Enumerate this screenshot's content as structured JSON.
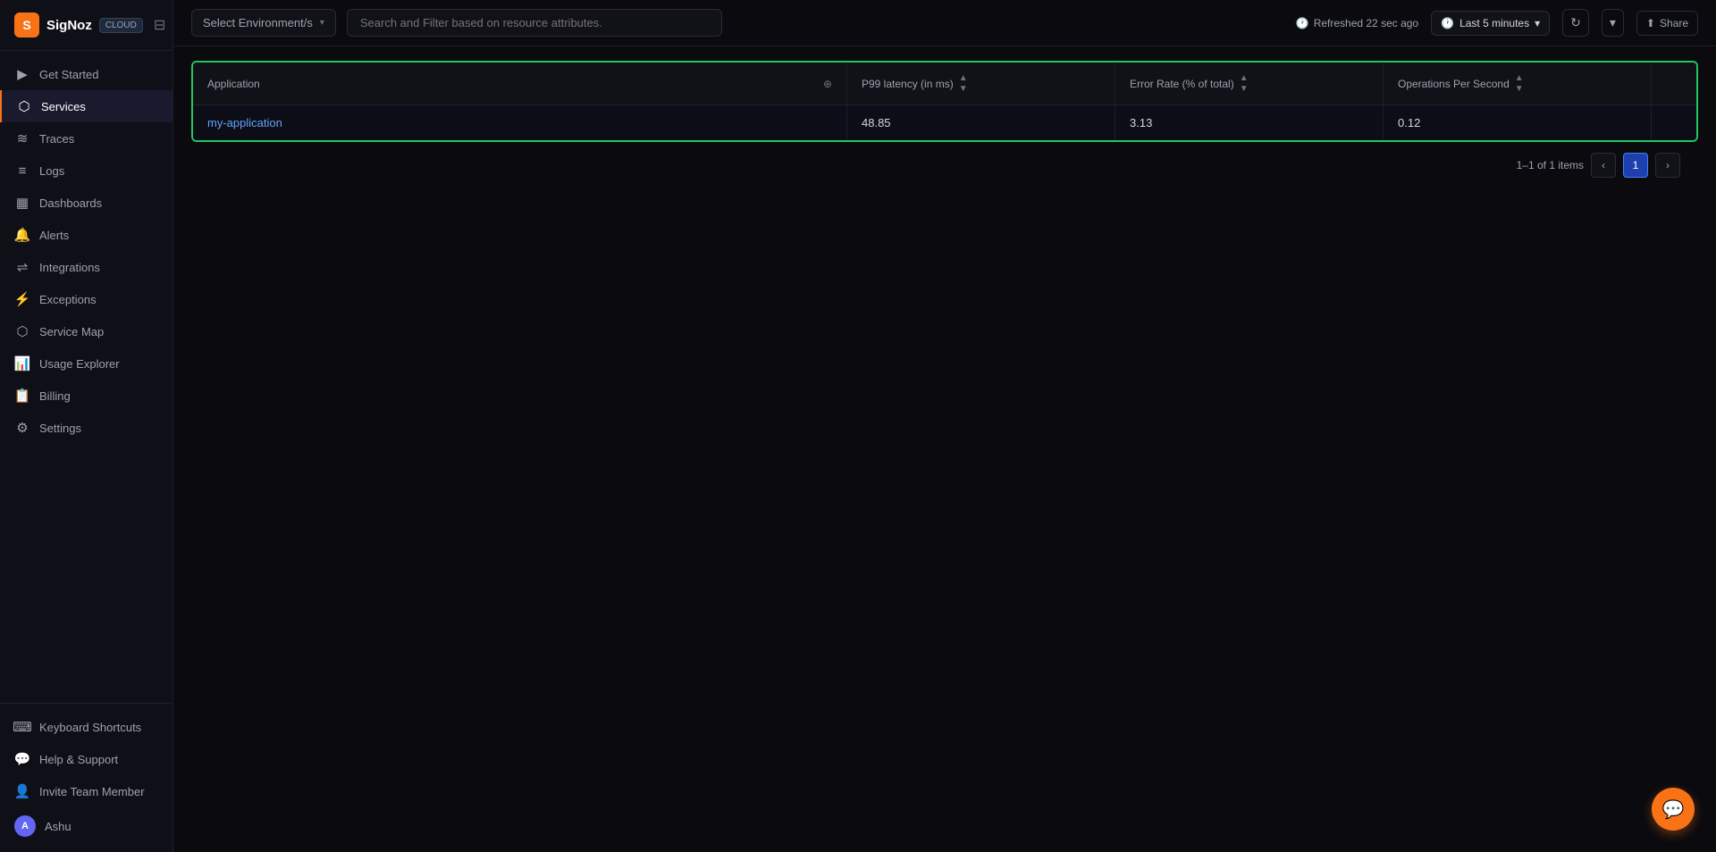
{
  "sidebar": {
    "logo": {
      "text": "SigNoz",
      "icon_letter": "S",
      "badge": "CLOUD"
    },
    "nav_items": [
      {
        "id": "get-started",
        "label": "Get Started",
        "icon": "🚀",
        "active": false
      },
      {
        "id": "services",
        "label": "Services",
        "icon": "⬡",
        "active": true
      },
      {
        "id": "traces",
        "label": "Traces",
        "icon": "📊",
        "active": false
      },
      {
        "id": "logs",
        "label": "Logs",
        "icon": "📄",
        "active": false
      },
      {
        "id": "dashboards",
        "label": "Dashboards",
        "icon": "▦",
        "active": false
      },
      {
        "id": "alerts",
        "label": "Alerts",
        "icon": "🔔",
        "active": false
      },
      {
        "id": "integrations",
        "label": "Integrations",
        "icon": "🔗",
        "active": false
      },
      {
        "id": "exceptions",
        "label": "Exceptions",
        "icon": "⚡",
        "active": false
      },
      {
        "id": "service-map",
        "label": "Service Map",
        "icon": "🗺",
        "active": false
      },
      {
        "id": "usage-explorer",
        "label": "Usage Explorer",
        "icon": "📈",
        "active": false
      },
      {
        "id": "billing",
        "label": "Billing",
        "icon": "🧾",
        "active": false
      },
      {
        "id": "settings",
        "label": "Settings",
        "icon": "⚙",
        "active": false
      }
    ],
    "bottom_items": [
      {
        "id": "keyboard-shortcuts",
        "label": "Keyboard Shortcuts",
        "icon": "⌨"
      },
      {
        "id": "help-support",
        "label": "Help & Support",
        "icon": "💬"
      },
      {
        "id": "invite-team",
        "label": "Invite Team Member",
        "icon": "👥"
      }
    ],
    "user": {
      "name": "Ashu",
      "avatar_text": "A"
    }
  },
  "topbar": {
    "env_select": {
      "placeholder": "Select Environment/s",
      "arrow": "▾"
    },
    "search": {
      "placeholder": "Search and Filter based on resource attributes."
    },
    "refresh_text": "Refreshed 22 sec ago",
    "time_range": "Last 5 minutes",
    "time_icon": "🕐",
    "share_label": "Share",
    "refresh_icon": "↻",
    "dropdown_arrow": "▾"
  },
  "table": {
    "columns": [
      {
        "id": "application",
        "label": "Application",
        "sortable": true,
        "filterable": true
      },
      {
        "id": "p99",
        "label": "P99 latency (in ms)",
        "sortable": true,
        "filterable": false
      },
      {
        "id": "error_rate",
        "label": "Error Rate (% of total)",
        "sortable": true,
        "filterable": false
      },
      {
        "id": "ops_per_second",
        "label": "Operations Per Second",
        "sortable": true,
        "filterable": false
      }
    ],
    "rows": [
      {
        "application": "my-application",
        "p99": "48.85",
        "error_rate": "3.13",
        "ops_per_second": "0.12"
      }
    ],
    "pagination": {
      "summary": "1–1 of 1 items",
      "current_page": 1,
      "total_pages": 1,
      "prev_disabled": true,
      "next_disabled": true
    }
  },
  "chat_fab": {
    "icon": "💬"
  }
}
